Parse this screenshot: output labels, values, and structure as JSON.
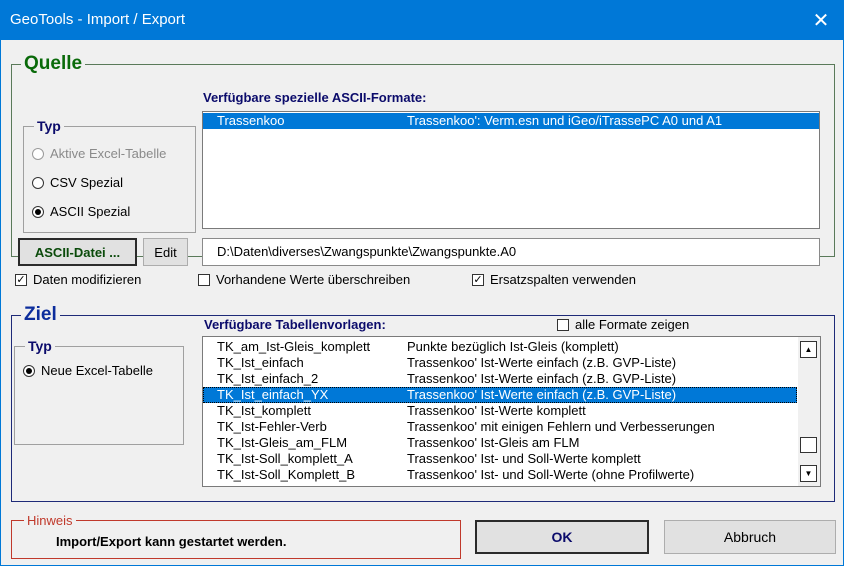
{
  "window": {
    "title": "GeoTools - Import / Export",
    "close_glyph": "✕"
  },
  "quelle": {
    "legend": "Quelle",
    "typ": {
      "legend": "Typ",
      "options": [
        {
          "label": "Aktive Excel-Tabelle",
          "selected": false,
          "enabled": false
        },
        {
          "label": "CSV Spezial",
          "selected": false,
          "enabled": true
        },
        {
          "label": "ASCII Spezial",
          "selected": true,
          "enabled": true
        }
      ]
    },
    "formats_label": "Verfügbare spezielle ASCII-Formate:",
    "formats": [
      {
        "name": "Trassenkoo",
        "desc": "Trassenkoo': Verm.esn und iGeo/iTrassePC A0 und A1",
        "selected": true
      }
    ],
    "ascii_button": "ASCII-Datei ...",
    "edit_button": "Edit",
    "file_path": "D:\\Daten\\diverses\\Zwangspunkte\\Zwangspunkte.A0"
  },
  "options": {
    "daten_modifizieren": {
      "label": "Daten modifizieren",
      "checked": true
    },
    "werte_ueberschreiben": {
      "label": "Vorhandene Werte überschreiben",
      "checked": false
    },
    "ersatzspalten": {
      "label": "Ersatzspalten verwenden",
      "checked": true
    }
  },
  "ziel": {
    "legend": "Ziel",
    "typ": {
      "legend": "Typ",
      "options": [
        {
          "label": "Neue Excel-Tabelle",
          "selected": true
        }
      ]
    },
    "templates_label": "Verfügbare Tabellenvorlagen:",
    "alle_formate": {
      "label": "alle Formate zeigen",
      "checked": false
    },
    "templates": [
      {
        "name": "TK_am_Ist-Gleis_komplett",
        "desc": "Punkte bezüglich Ist-Gleis (komplett)",
        "selected": false
      },
      {
        "name": "TK_Ist_einfach",
        "desc": "Trassenkoo' Ist-Werte einfach (z.B. GVP-Liste)",
        "selected": false
      },
      {
        "name": "TK_Ist_einfach_2",
        "desc": "Trassenkoo' Ist-Werte einfach (z.B. GVP-Liste)",
        "selected": false
      },
      {
        "name": "TK_Ist_einfach_YX",
        "desc": "Trassenkoo' Ist-Werte einfach (z.B. GVP-Liste)",
        "selected": true
      },
      {
        "name": "TK_Ist_komplett",
        "desc": "Trassenkoo' Ist-Werte komplett",
        "selected": false
      },
      {
        "name": "TK_Ist-Fehler-Verb",
        "desc": "Trassenkoo' mit einigen Fehlern und Verbesserungen",
        "selected": false
      },
      {
        "name": "TK_Ist-Gleis_am_FLM",
        "desc": "Trassenkoo' Ist-Gleis am FLM",
        "selected": false
      },
      {
        "name": "TK_Ist-Soll_komplett_A",
        "desc": "Trassenkoo' Ist- und Soll-Werte komplett",
        "selected": false
      },
      {
        "name": "TK_Ist-Soll_Komplett_B",
        "desc": "Trassenkoo' Ist- und Soll-Werte (ohne Profilwerte)",
        "selected": false
      }
    ],
    "scroll_up_glyph": "▲",
    "scroll_down_glyph": "▼"
  },
  "hinweis": {
    "legend": "Hinweis",
    "message": "Import/Export kann gestartet werden."
  },
  "buttons": {
    "ok": "OK",
    "cancel": "Abbruch"
  }
}
